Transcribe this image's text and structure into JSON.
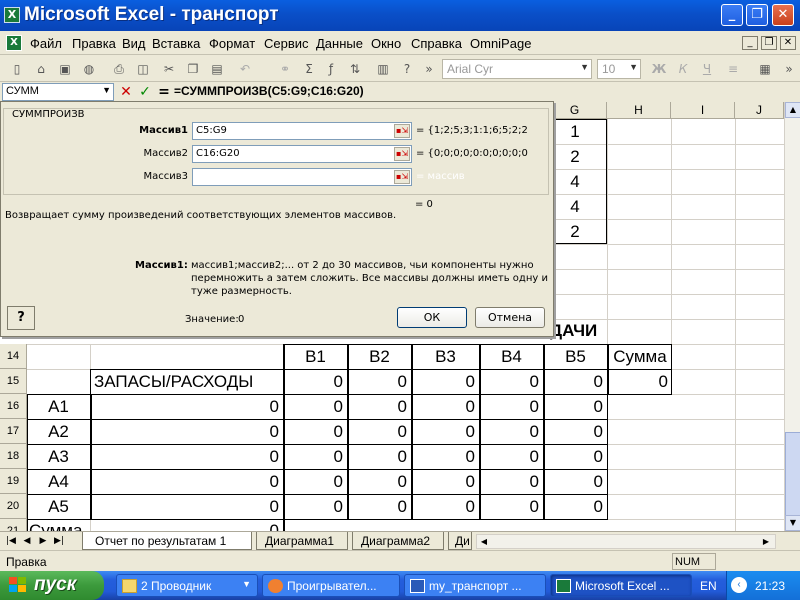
{
  "window": {
    "title": "Microsoft Excel - транспорт",
    "app_icon": "excel-icon"
  },
  "menu": [
    "Файл",
    "Правка",
    "Вид",
    "Вставка",
    "Формат",
    "Сервис",
    "Данные",
    "Окно",
    "Справка",
    "OmniPage"
  ],
  "toolbar": {
    "font_name": "Arial Cyr",
    "font_size": "10"
  },
  "formula_bar": {
    "name_box": "СУММ",
    "formula": "=СУММПРОИЗВ(C5:G9;C16:G20)",
    "cancel": "✕",
    "enter": "✓",
    "equals": "="
  },
  "columns": [
    "G",
    "H",
    "I",
    "J"
  ],
  "upper_cells": [
    "1",
    "2",
    "4",
    "4",
    "2"
  ],
  "table": {
    "title": "ДАЧИ",
    "header": [
      "B1",
      "B2",
      "B3",
      "B4",
      "B5",
      "Сумма"
    ],
    "supply_label": "ЗАПАСЫ/РАСХОДЫ",
    "supply_values": [
      "0",
      "0",
      "0",
      "0",
      "0",
      "0"
    ],
    "rows": [
      {
        "num": "16",
        "label": "A1",
        "total": "0",
        "values": [
          "0",
          "0",
          "0",
          "0",
          "0"
        ]
      },
      {
        "num": "17",
        "label": "A2",
        "total": "0",
        "values": [
          "0",
          "0",
          "0",
          "0",
          "0"
        ]
      },
      {
        "num": "18",
        "label": "A3",
        "total": "0",
        "values": [
          "0",
          "0",
          "0",
          "0",
          "0"
        ]
      },
      {
        "num": "19",
        "label": "A4",
        "total": "0",
        "values": [
          "0",
          "0",
          "0",
          "0",
          "0"
        ]
      },
      {
        "num": "20",
        "label": "A5",
        "total": "0",
        "values": [
          "0",
          "0",
          "0",
          "0",
          "0"
        ]
      }
    ],
    "row_nums": {
      "r14": "14",
      "r15": "15",
      "r21": "21"
    },
    "sum_label": "Сумма",
    "sum_value": "0"
  },
  "dialog": {
    "function_name": "СУММПРОИЗВ",
    "args": [
      {
        "label": "Массив1",
        "value": "C5:G9",
        "result": "= {1;2;5;3;1:1;6;5;2;2"
      },
      {
        "label": "Массив2",
        "value": "C16:G20",
        "result": "= {0;0;0;0;0:0;0;0;0;0"
      },
      {
        "label": "Массив3",
        "value": "",
        "result": "= массив"
      }
    ],
    "result_total": "= 0",
    "description": "Возвращает сумму произведений соответствующих элементов массивов.",
    "arg_help_label": "Массив1:",
    "arg_help_line1": "массив1;массив2;... от 2 до 30 массивов, чьи компоненты нужно",
    "arg_help_line2": "перемножить а затем сложить. Все массивы должны иметь одну и",
    "arg_help_line3": "туже размерность.",
    "value_label": "Значение:",
    "value": "0",
    "ok": "ОК",
    "cancel": "Отмена",
    "help": "?"
  },
  "sheet_tabs": [
    "Отчет по результатам 1",
    "Диаграмма1",
    "Диаграмма2",
    "Ди"
  ],
  "status": {
    "text": "Правка",
    "num": "NUM"
  },
  "taskbar": {
    "start": "пуск",
    "tasks": [
      "2 Проводник",
      "Проигрывател...",
      "my_транспорт ...",
      "Microsoft Excel ..."
    ],
    "lang": "EN",
    "clock": "21:23"
  },
  "colors": {
    "accent": "#0a4fc8",
    "start_green": "#3c9a3c"
  }
}
